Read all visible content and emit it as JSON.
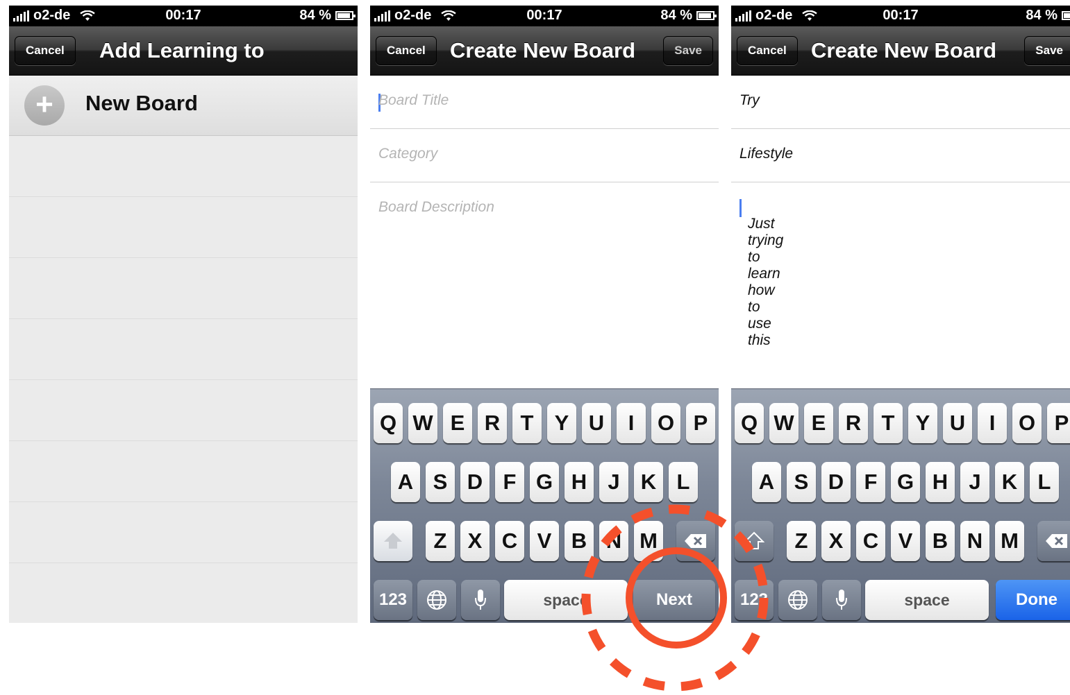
{
  "status_bar": {
    "carrier": "o2-de",
    "time": "00:17",
    "battery": "84 %"
  },
  "screen1": {
    "cancel_label": "Cancel",
    "title": "Add Learning to",
    "new_board_label": "New Board",
    "plus_glyph": "+"
  },
  "screen2": {
    "cancel_label": "Cancel",
    "title": "Create New Board",
    "save_label": "Save",
    "board_title_placeholder": "Board Title",
    "category_placeholder": "Category",
    "description_placeholder": "Board Description",
    "return_key_label": "Next"
  },
  "screen3": {
    "cancel_label": "Cancel",
    "title": "Create New Board",
    "save_label": "Save",
    "board_title_value": "Try",
    "category_value": "Lifestyle",
    "description_value": "Just trying to learn how to use this",
    "return_key_label": "Done"
  },
  "keyboard": {
    "row1": [
      "Q",
      "W",
      "E",
      "R",
      "T",
      "Y",
      "U",
      "I",
      "O",
      "P"
    ],
    "row2": [
      "A",
      "S",
      "D",
      "F",
      "G",
      "H",
      "J",
      "K",
      "L"
    ],
    "row3": [
      "Z",
      "X",
      "C",
      "V",
      "B",
      "N",
      "M"
    ],
    "numbers_label": "123",
    "space_label": "space",
    "globe_icon": "globe-icon",
    "mic_icon": "microphone-icon",
    "shift_icon": "shift-icon",
    "delete_icon": "backspace-icon"
  },
  "colors": {
    "annotation_red": "#f4502b",
    "done_blue": "#1a63e8",
    "caret_blue": "#4a7ef0"
  }
}
